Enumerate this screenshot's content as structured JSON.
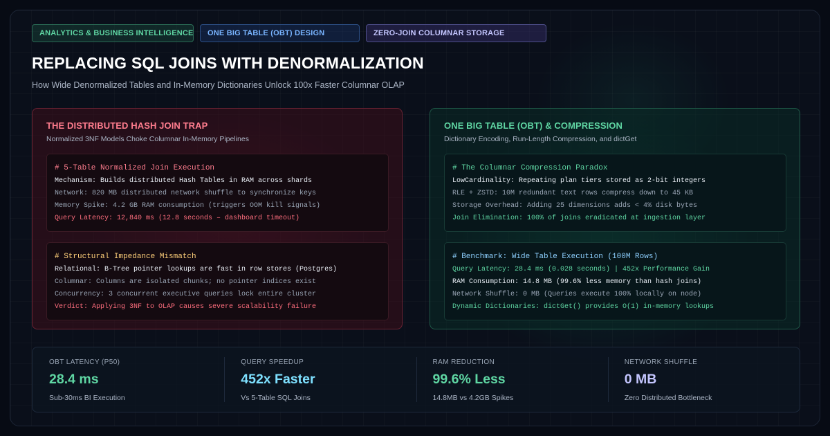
{
  "tags": [
    "ANALYTICS & BUSINESS INTELLIGENCE",
    "ONE BIG TABLE (OBT) DESIGN",
    "ZERO-JOIN COLUMNAR STORAGE"
  ],
  "title": "REPLACING SQL JOINS WITH DENORMALIZATION",
  "subtitle": "How Wide Denormalized Tables and In-Memory Dictionaries Unlock 100x Faster Columnar OLAP",
  "left_panel": {
    "title": "THE DISTRIBUTED HASH JOIN TRAP",
    "subtitle": "Normalized 3NF Models Choke Columnar In-Memory Pipelines",
    "block1": {
      "heading": "# 5-Table Normalized Join Execution",
      "lines": [
        "Mechanism: Builds distributed Hash Tables in RAM across shards",
        "Network: 820 MB distributed network shuffle to synchronize keys",
        "Memory Spike: 4.2 GB RAM consumption (triggers OOM kill signals)",
        "Query Latency: 12,840 ms (12.8 seconds – dashboard timeout)"
      ]
    },
    "block2": {
      "heading": "# Structural Impedance Mismatch",
      "lines": [
        "Relational: B-Tree pointer lookups are fast in row stores (Postgres)",
        "Columnar: Columns are isolated chunks; no pointer indices exist",
        "Concurrency: 3 concurrent executive queries lock entire cluster",
        "Verdict: Applying 3NF to OLAP causes severe scalability failure"
      ]
    }
  },
  "right_panel": {
    "title": "ONE BIG TABLE (OBT) & COMPRESSION",
    "subtitle": "Dictionary Encoding, Run-Length Compression, and dictGet",
    "block1": {
      "heading": "# The Columnar Compression Paradox",
      "lines": [
        "LowCardinality: Repeating plan tiers stored as 2-bit integers",
        "RLE + ZSTD: 10M redundant text rows compress down to 45 KB",
        "Storage Overhead: Adding 25 dimensions adds < 4% disk bytes",
        "Join Elimination: 100% of joins eradicated at ingestion layer"
      ]
    },
    "block2": {
      "heading": "# Benchmark: Wide Table Execution (100M Rows)",
      "lines": [
        "Query Latency: 28.4 ms (0.028 seconds) | 452x Performance Gain",
        "RAM Consumption: 14.8 MB (99.6% less memory than hash joins)",
        "Network Shuffle: 0 MB (Queries execute 100% locally on node)",
        "Dynamic Dictionaries: dictGet() provides O(1) in-memory lookups"
      ]
    }
  },
  "metrics": [
    {
      "label": "OBT LATENCY (P50)",
      "value": "28.4 ms",
      "note": "Sub-30ms BI Execution",
      "color": "#5fd6a3"
    },
    {
      "label": "QUERY SPEEDUP",
      "value": "452x Faster",
      "note": "Vs 5-Table SQL Joins",
      "color": "#7ee0ff"
    },
    {
      "label": "RAM REDUCTION",
      "value": "99.6% Less",
      "note": "14.8MB vs 4.2GB Spikes",
      "color": "#5fd6a3"
    },
    {
      "label": "NETWORK SHUFFLE",
      "value": "0 MB",
      "note": "Zero Distributed Bottleneck",
      "color": "#c4c6ff"
    }
  ]
}
